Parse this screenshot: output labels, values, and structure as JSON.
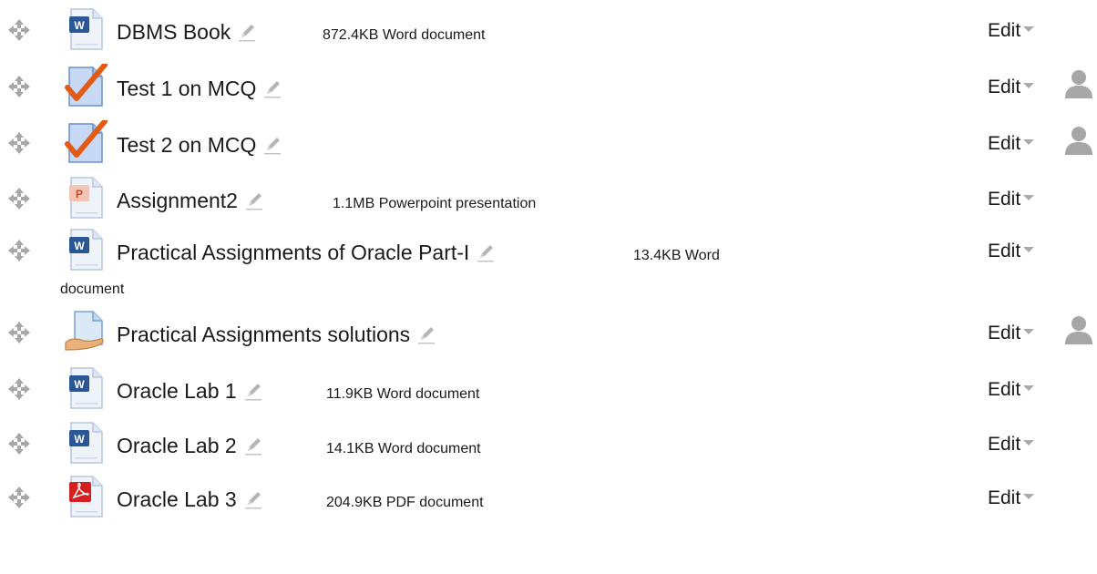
{
  "colors": {
    "icon_grey": "#a7a7a7",
    "text": "#1a1a1a",
    "word_blue": "#2b5797",
    "ppt_orange": "#d24726",
    "pdf_red": "#d42020",
    "check_orange": "#e35a14"
  },
  "items": [
    {
      "name": "DBMS Book",
      "meta": "872.4KB Word document",
      "meta_cont": "",
      "icon": "word-file-icon",
      "edit": "Edit",
      "has_permission": false
    },
    {
      "name": "Test 1 on MCQ",
      "meta": "",
      "meta_cont": "",
      "icon": "quiz-icon",
      "edit": "Edit",
      "has_permission": true
    },
    {
      "name": "Test 2 on MCQ",
      "meta": "",
      "meta_cont": "",
      "icon": "quiz-icon",
      "edit": "Edit",
      "has_permission": true
    },
    {
      "name": "Assignment2",
      "meta": "1.1MB Powerpoint presentation",
      "meta_cont": "",
      "icon": "powerpoint-file-icon",
      "edit": "Edit",
      "has_permission": false
    },
    {
      "name": "Practical Assignments of Oracle Part-I",
      "meta": "13.4KB Word",
      "meta_cont": "document",
      "icon": "word-file-icon",
      "edit": "Edit",
      "has_permission": false
    },
    {
      "name": "Practical Assignments solutions",
      "meta": "",
      "meta_cont": "",
      "icon": "assignment-icon",
      "edit": "Edit",
      "has_permission": true
    },
    {
      "name": "Oracle Lab 1",
      "meta": "11.9KB Word document",
      "meta_cont": "",
      "icon": "word-file-icon",
      "edit": "Edit",
      "has_permission": false
    },
    {
      "name": "Oracle Lab 2",
      "meta": "14.1KB Word document",
      "meta_cont": "",
      "icon": "word-file-icon",
      "edit": "Edit",
      "has_permission": false
    },
    {
      "name": "Oracle Lab 3",
      "meta": "204.9KB PDF document",
      "meta_cont": "",
      "icon": "pdf-file-icon",
      "edit": "Edit",
      "has_permission": false
    }
  ]
}
